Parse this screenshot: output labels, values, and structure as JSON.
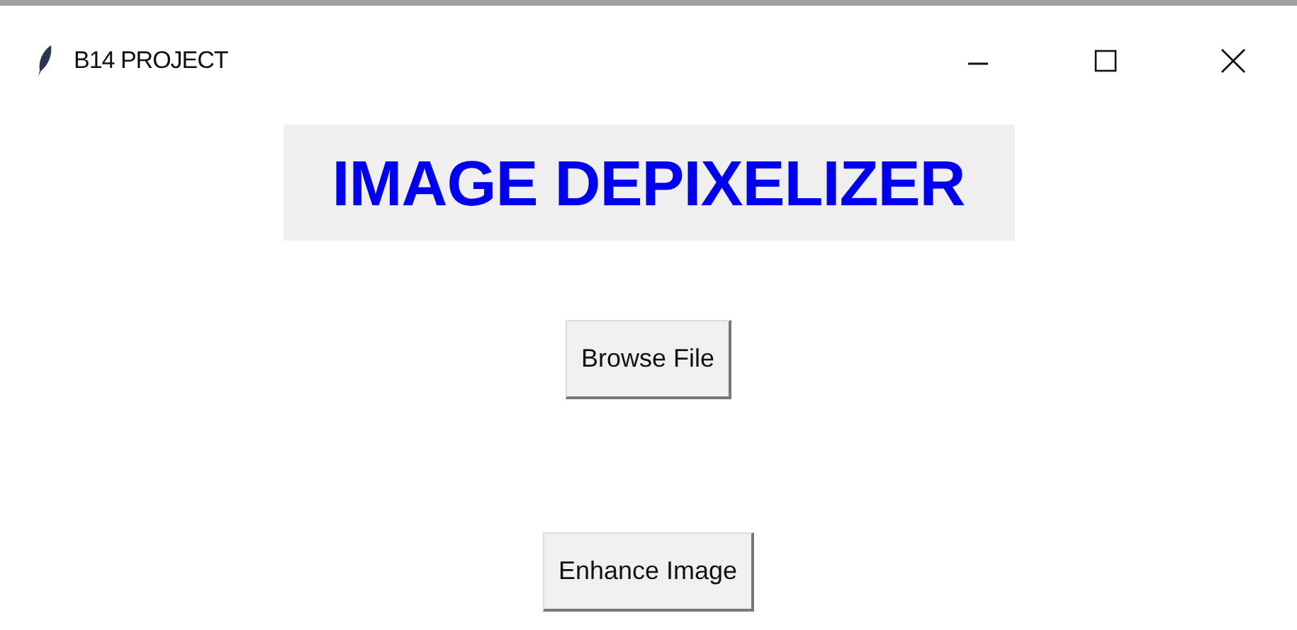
{
  "window": {
    "title": "B14 PROJECT"
  },
  "heading": "IMAGE DEPIXELIZER",
  "buttons": [
    "Browse File",
    "Enhance Image"
  ]
}
